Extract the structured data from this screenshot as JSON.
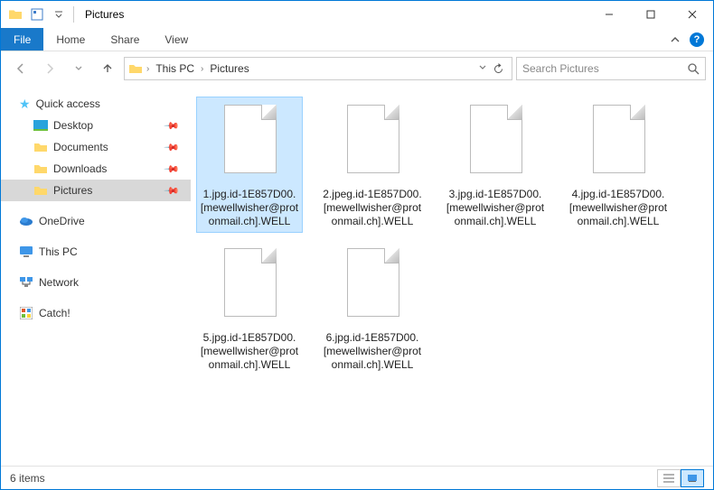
{
  "window": {
    "title": "Pictures",
    "minimize": "—",
    "maximize": "☐",
    "close": "✕"
  },
  "ribbon": {
    "file": "File",
    "tabs": [
      "Home",
      "Share",
      "View"
    ]
  },
  "breadcrumb": {
    "items": [
      "This PC",
      "Pictures"
    ]
  },
  "search": {
    "placeholder": "Search Pictures"
  },
  "sidebar": {
    "quick_access": "Quick access",
    "pinned": [
      {
        "label": "Desktop"
      },
      {
        "label": "Documents"
      },
      {
        "label": "Downloads"
      },
      {
        "label": "Pictures"
      }
    ],
    "onedrive": "OneDrive",
    "thispc": "This PC",
    "network": "Network",
    "catch": "Catch!"
  },
  "files": [
    {
      "name": "1.jpg.id-1E857D00.[mewellwisher@protonmail.ch].WELL"
    },
    {
      "name": "2.jpeg.id-1E857D00.[mewellwisher@protonmail.ch].WELL"
    },
    {
      "name": "3.jpg.id-1E857D00.[mewellwisher@protonmail.ch].WELL"
    },
    {
      "name": "4.jpg.id-1E857D00.[mewellwisher@protonmail.ch].WELL"
    },
    {
      "name": "5.jpg.id-1E857D00.[mewellwisher@protonmail.ch].WELL"
    },
    {
      "name": "6.jpg.id-1E857D00.[mewellwisher@protonmail.ch].WELL"
    }
  ],
  "status": {
    "count": "6 items"
  }
}
